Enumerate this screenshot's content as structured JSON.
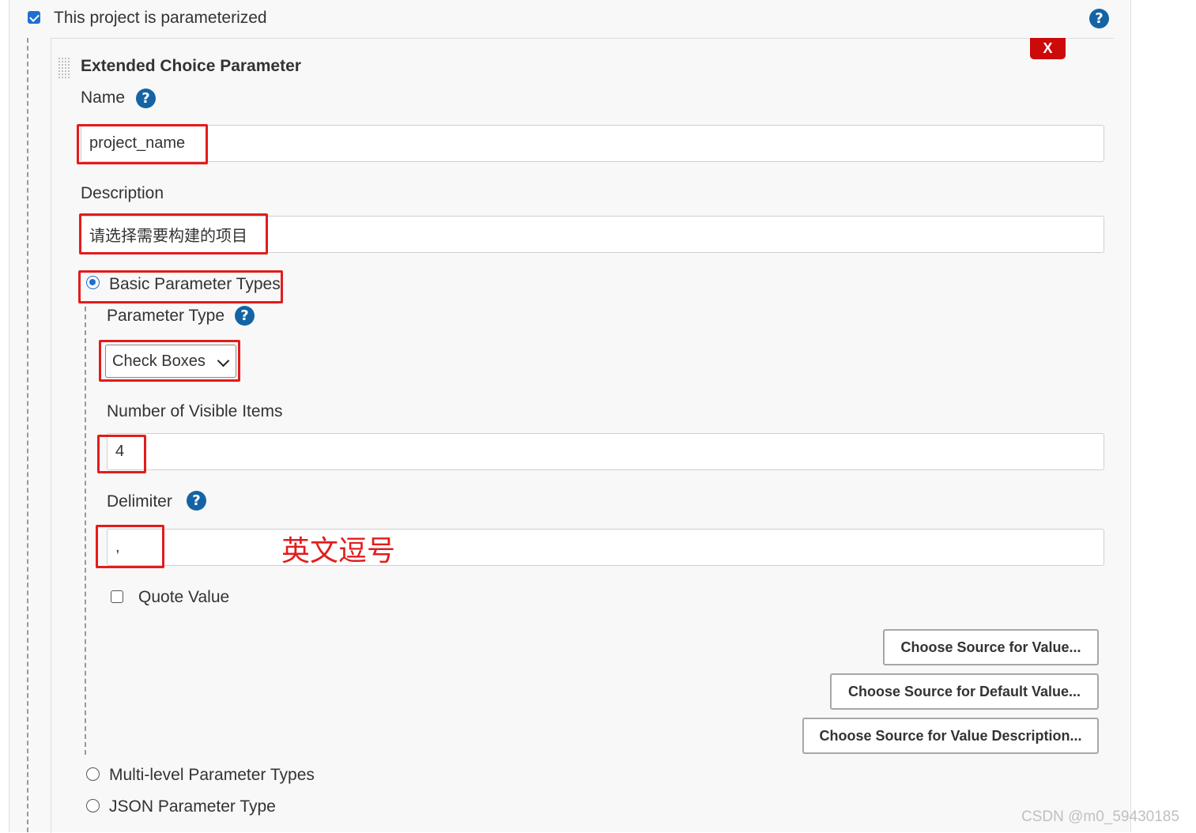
{
  "header": {
    "parameterized_label": "This project is parameterized",
    "parameterized_checked": true
  },
  "param_block": {
    "title": "Extended Choice Parameter",
    "delete_label": "X",
    "name": {
      "label": "Name",
      "value": "project_name"
    },
    "description": {
      "label": "Description",
      "value": "请选择需要构建的项目"
    },
    "param_type_options": {
      "basic": {
        "label": "Basic Parameter Types",
        "selected": true
      },
      "multi_level": {
        "label": "Multi-level Parameter Types",
        "selected": false
      },
      "json": {
        "label": "JSON Parameter Type",
        "selected": false
      }
    },
    "parameter_type": {
      "label": "Parameter Type",
      "value": "Check Boxes"
    },
    "visible_items": {
      "label": "Number of Visible Items",
      "value": "4"
    },
    "delimiter": {
      "label": "Delimiter",
      "value": ","
    },
    "quote_value": {
      "label": "Quote Value",
      "checked": false
    },
    "buttons": {
      "source_value": "Choose Source for Value...",
      "source_default": "Choose Source for Default Value...",
      "source_description": "Choose Source for Value Description..."
    }
  },
  "annotation": {
    "delimiter_note": "英文逗号",
    "color": "#e21c1c"
  },
  "watermark": "CSDN @m0_59430185",
  "colors": {
    "help_icon": "#1464a5",
    "accent": "#1e6fd1",
    "delete": "#cc0a0a"
  }
}
